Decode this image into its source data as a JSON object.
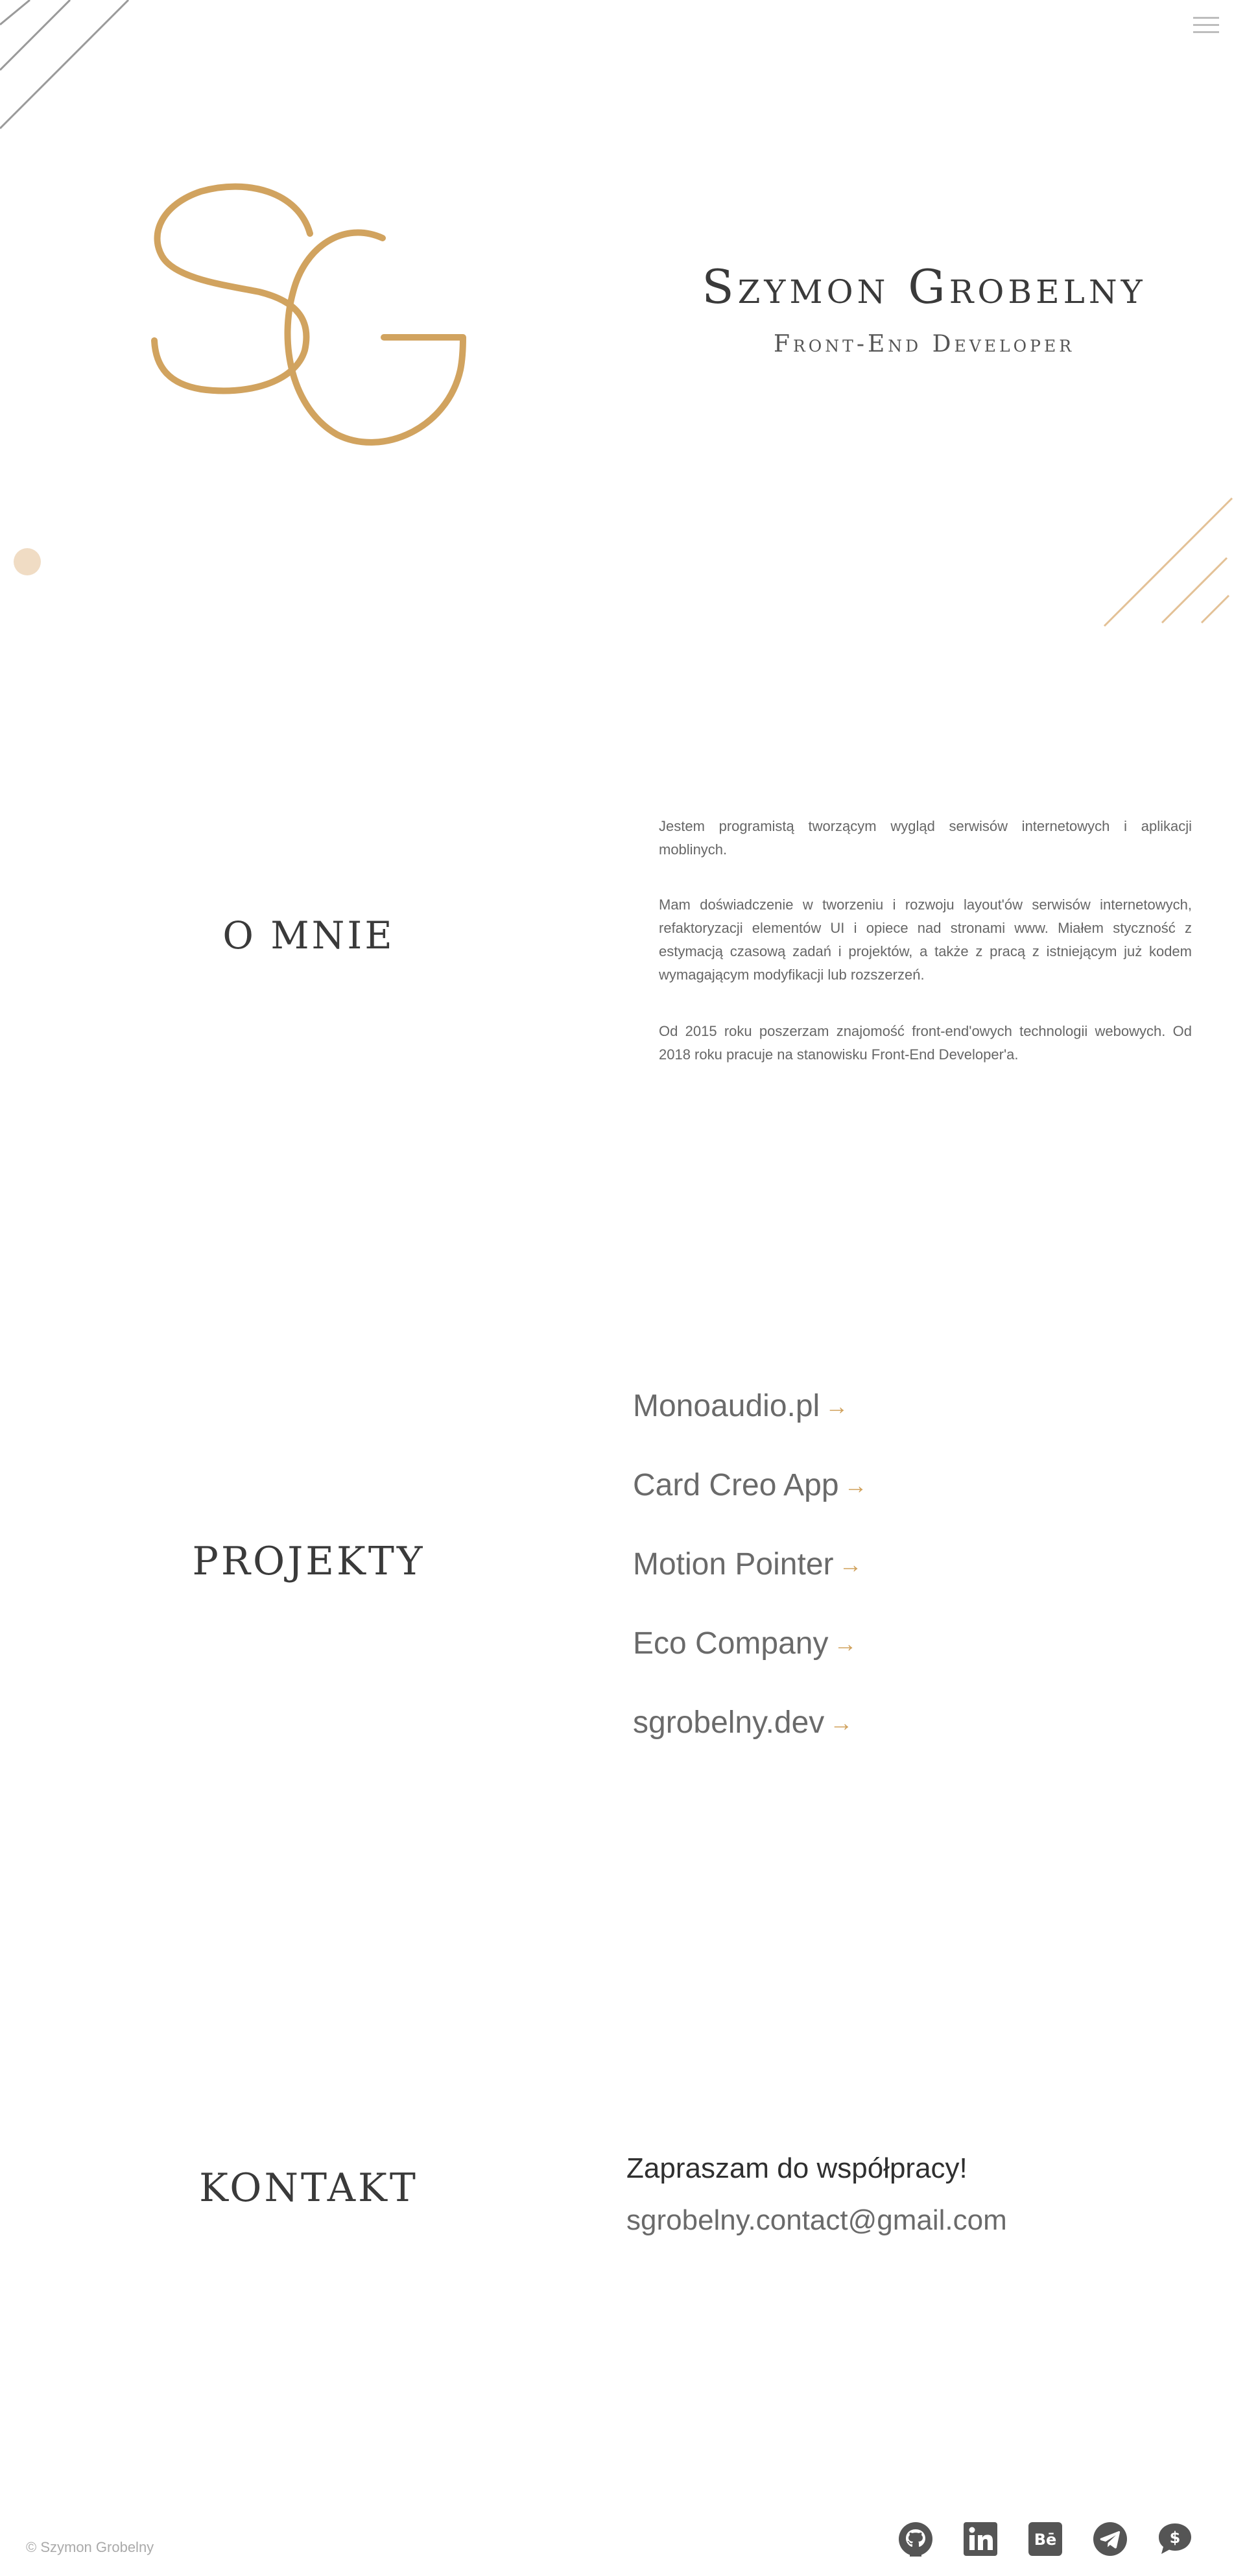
{
  "header": {
    "menu_icon": "hamburger-menu-icon"
  },
  "hero": {
    "logo_text": "SG",
    "name": "Szymon Grobelny",
    "role": "Front-End Developer"
  },
  "about": {
    "title": "O MNIE",
    "paragraphs": [
      "Jestem programistą tworzącym wygląd serwisów internetowych i aplikacji moblinych.",
      "Mam doświadczenie w tworzeniu i rozwoju layout'ów serwisów internetowych, refaktoryzacji elementów UI i opiece nad stronami www. Miałem styczność z estymacją czasową zadań i projektów, a także z pracą z istniejącym już kodem wymagającym modyfikacji lub rozszerzeń.",
      "Od 2015 roku poszerzam znajomość front-end'owych technologii webowych. Od 2018 roku pracuje na stanowisku Front-End Developer'a."
    ]
  },
  "projects": {
    "title": "PROJEKTY",
    "items": [
      {
        "label": "Monoaudio.pl",
        "arrow": "→"
      },
      {
        "label": "Card Creo App",
        "arrow": "→"
      },
      {
        "label": "Motion Pointer",
        "arrow": "→"
      },
      {
        "label": "Eco Company",
        "arrow": "→"
      },
      {
        "label": "sgrobelny.dev",
        "arrow": "→"
      }
    ]
  },
  "contact": {
    "title": "KONTAKT",
    "heading": "Zapraszam do współpracy!",
    "email": "sgrobelny.contact@gmail.com"
  },
  "footer": {
    "copyright": "© Szymon Grobelny",
    "social": [
      {
        "icon": "github-icon"
      },
      {
        "icon": "linkedin-icon"
      },
      {
        "icon": "behance-icon"
      },
      {
        "icon": "telegram-icon"
      },
      {
        "icon": "dollar-chat-icon"
      }
    ]
  },
  "colors": {
    "accent": "#d1a35f",
    "text_dark": "#3a3a3a",
    "text_muted": "#666666",
    "icon_gray": "#555555",
    "decor_line": "#9a9a9a",
    "decor_circle": "#f0dcc4"
  }
}
